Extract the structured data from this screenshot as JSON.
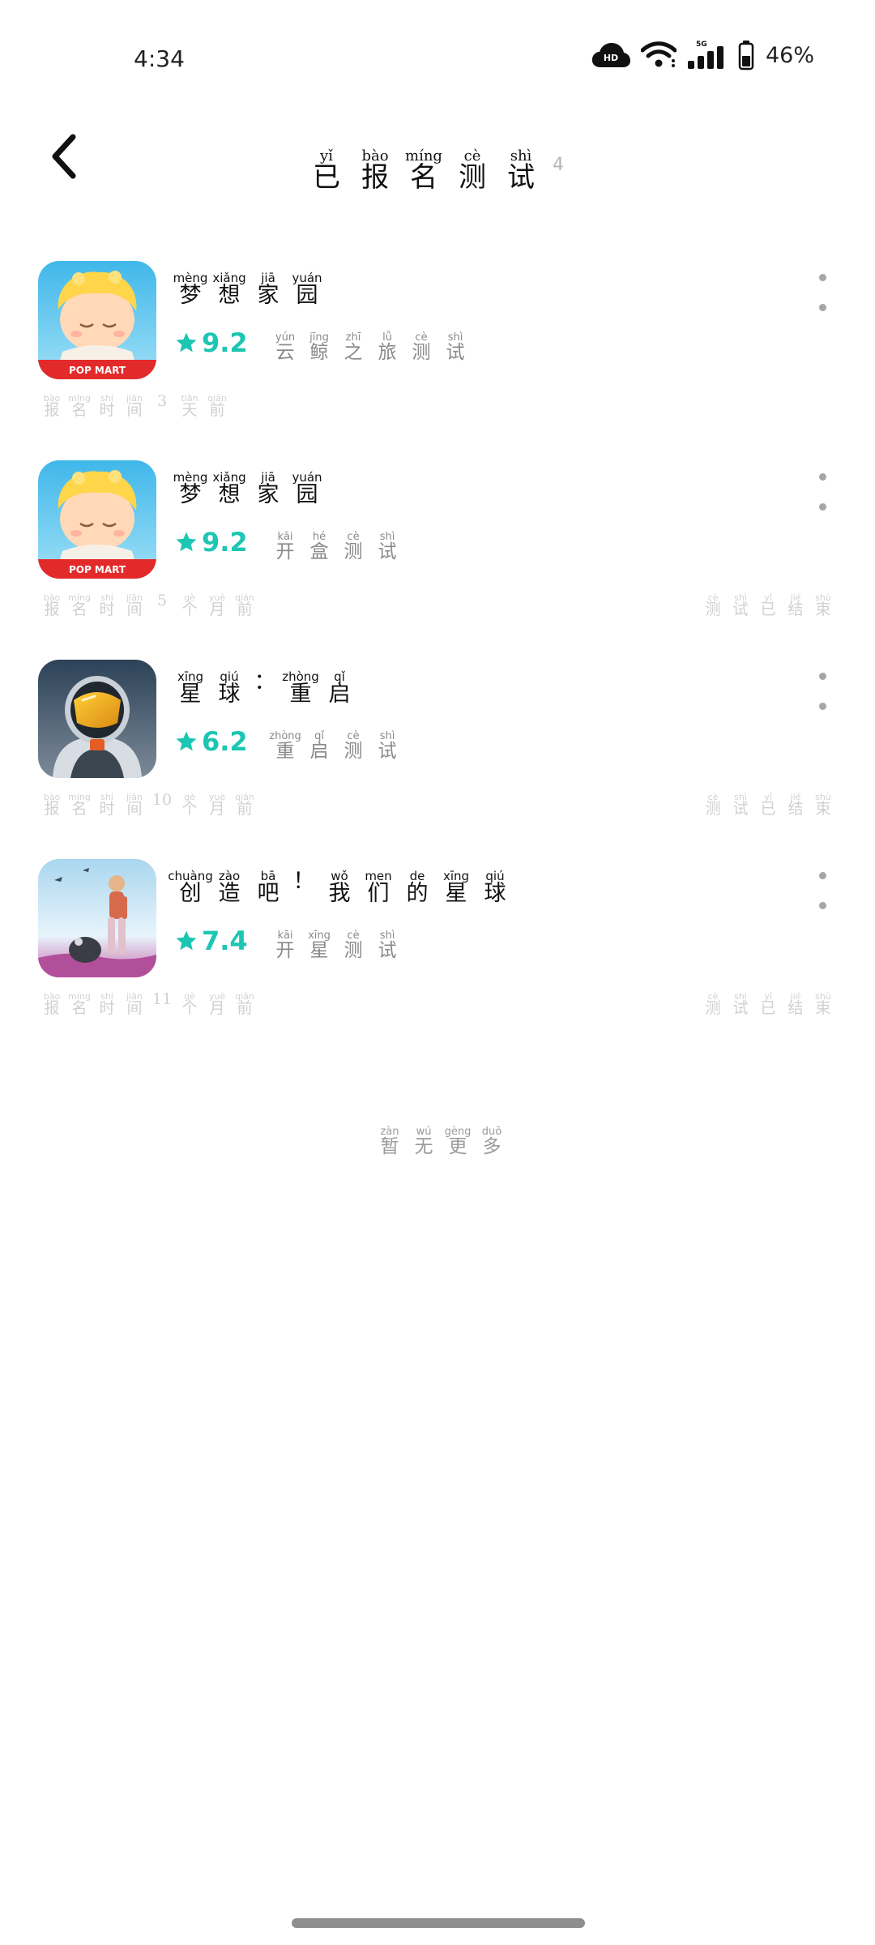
{
  "status_bar": {
    "time": "4:34",
    "battery_text": "46%",
    "icons": [
      "hd-cloud-icon",
      "wifi-icon",
      "5g-signal-icon",
      "battery-icon"
    ]
  },
  "header": {
    "title": [
      {
        "pin": "yǐ",
        "han": "已"
      },
      {
        "pin": "bào",
        "han": "报"
      },
      {
        "pin": "míng",
        "han": "名"
      },
      {
        "pin": "cè",
        "han": "测"
      },
      {
        "pin": "shì",
        "han": "试"
      }
    ],
    "count": "4"
  },
  "accent_color": "#1cc6b3",
  "games": [
    {
      "name": [
        {
          "pin": "mèng",
          "han": "梦"
        },
        {
          "pin": "xiǎng",
          "han": "想"
        },
        {
          "pin": "jiā",
          "han": "家"
        },
        {
          "pin": "yuán",
          "han": "园"
        }
      ],
      "rating": "9.2",
      "test_label": [
        {
          "pin": "yún",
          "han": "云"
        },
        {
          "pin": "jīng",
          "han": "鲸"
        },
        {
          "pin": "zhī",
          "han": "之"
        },
        {
          "pin": "lǚ",
          "han": "旅"
        },
        {
          "pin": "cè",
          "han": "测"
        },
        {
          "pin": "shì",
          "han": "试"
        }
      ],
      "signup_time": [
        {
          "pin": "bào",
          "han": "报"
        },
        {
          "pin": "míng",
          "han": "名"
        },
        {
          "pin": "shí",
          "han": "时"
        },
        {
          "pin": "jiān",
          "han": "间"
        },
        {
          "pin": "",
          "han": "3"
        },
        {
          "pin": "tiān",
          "han": "天"
        },
        {
          "pin": "qián",
          "han": "前"
        }
      ],
      "status": [],
      "icon_badge": "POP MART"
    },
    {
      "name": [
        {
          "pin": "mèng",
          "han": "梦"
        },
        {
          "pin": "xiǎng",
          "han": "想"
        },
        {
          "pin": "jiā",
          "han": "家"
        },
        {
          "pin": "yuán",
          "han": "园"
        }
      ],
      "rating": "9.2",
      "test_label": [
        {
          "pin": "kāi",
          "han": "开"
        },
        {
          "pin": "hé",
          "han": "盒"
        },
        {
          "pin": "cè",
          "han": "测"
        },
        {
          "pin": "shì",
          "han": "试"
        }
      ],
      "signup_time": [
        {
          "pin": "bào",
          "han": "报"
        },
        {
          "pin": "míng",
          "han": "名"
        },
        {
          "pin": "shí",
          "han": "时"
        },
        {
          "pin": "jiān",
          "han": "间"
        },
        {
          "pin": "",
          "han": "5"
        },
        {
          "pin": "gè",
          "han": "个"
        },
        {
          "pin": "yuè",
          "han": "月"
        },
        {
          "pin": "qián",
          "han": "前"
        }
      ],
      "status": [
        {
          "pin": "cè",
          "han": "测"
        },
        {
          "pin": "shì",
          "han": "试"
        },
        {
          "pin": "yǐ",
          "han": "已"
        },
        {
          "pin": "jié",
          "han": "结"
        },
        {
          "pin": "shù",
          "han": "束"
        }
      ],
      "icon_badge": "POP MART"
    },
    {
      "name": [
        {
          "pin": "xīng",
          "han": "星"
        },
        {
          "pin": "qiú",
          "han": "球"
        },
        {
          "pin": "",
          "han": "："
        },
        {
          "pin": "zhòng",
          "han": "重"
        },
        {
          "pin": "qǐ",
          "han": "启"
        }
      ],
      "rating": "6.2",
      "test_label": [
        {
          "pin": "zhòng",
          "han": "重"
        },
        {
          "pin": "qǐ",
          "han": "启"
        },
        {
          "pin": "cè",
          "han": "测"
        },
        {
          "pin": "shì",
          "han": "试"
        }
      ],
      "signup_time": [
        {
          "pin": "bào",
          "han": "报"
        },
        {
          "pin": "míng",
          "han": "名"
        },
        {
          "pin": "shí",
          "han": "时"
        },
        {
          "pin": "jiān",
          "han": "间"
        },
        {
          "pin": "",
          "han": "10"
        },
        {
          "pin": "gè",
          "han": "个"
        },
        {
          "pin": "yuè",
          "han": "月"
        },
        {
          "pin": "qián",
          "han": "前"
        }
      ],
      "status": [
        {
          "pin": "cè",
          "han": "测"
        },
        {
          "pin": "shì",
          "han": "试"
        },
        {
          "pin": "yǐ",
          "han": "已"
        },
        {
          "pin": "jié",
          "han": "结"
        },
        {
          "pin": "shù",
          "han": "束"
        }
      ],
      "icon_badge": ""
    },
    {
      "name": [
        {
          "pin": "chuàng",
          "han": "创"
        },
        {
          "pin": "zào",
          "han": "造"
        },
        {
          "pin": "bā",
          "han": "吧"
        },
        {
          "pin": "",
          "han": "！"
        },
        {
          "pin": "wǒ",
          "han": "我"
        },
        {
          "pin": "men",
          "han": "们"
        },
        {
          "pin": "de",
          "han": "的"
        },
        {
          "pin": "xīng",
          "han": "星"
        },
        {
          "pin": "qiú",
          "han": "球"
        }
      ],
      "rating": "7.4",
      "test_label": [
        {
          "pin": "kāi",
          "han": "开"
        },
        {
          "pin": "xīng",
          "han": "星"
        },
        {
          "pin": "cè",
          "han": "测"
        },
        {
          "pin": "shì",
          "han": "试"
        }
      ],
      "signup_time": [
        {
          "pin": "bào",
          "han": "报"
        },
        {
          "pin": "míng",
          "han": "名"
        },
        {
          "pin": "shí",
          "han": "时"
        },
        {
          "pin": "jiān",
          "han": "间"
        },
        {
          "pin": "",
          "han": "11"
        },
        {
          "pin": "gè",
          "han": "个"
        },
        {
          "pin": "yuè",
          "han": "月"
        },
        {
          "pin": "qián",
          "han": "前"
        }
      ],
      "status": [
        {
          "pin": "cè",
          "han": "测"
        },
        {
          "pin": "shì",
          "han": "试"
        },
        {
          "pin": "yǐ",
          "han": "已"
        },
        {
          "pin": "jié",
          "han": "结"
        },
        {
          "pin": "shù",
          "han": "束"
        }
      ],
      "icon_badge": ""
    }
  ],
  "footer": {
    "no_more": [
      {
        "pin": "zàn",
        "han": "暂"
      },
      {
        "pin": "wú",
        "han": "无"
      },
      {
        "pin": "gèng",
        "han": "更"
      },
      {
        "pin": "duō",
        "han": "多"
      }
    ]
  }
}
